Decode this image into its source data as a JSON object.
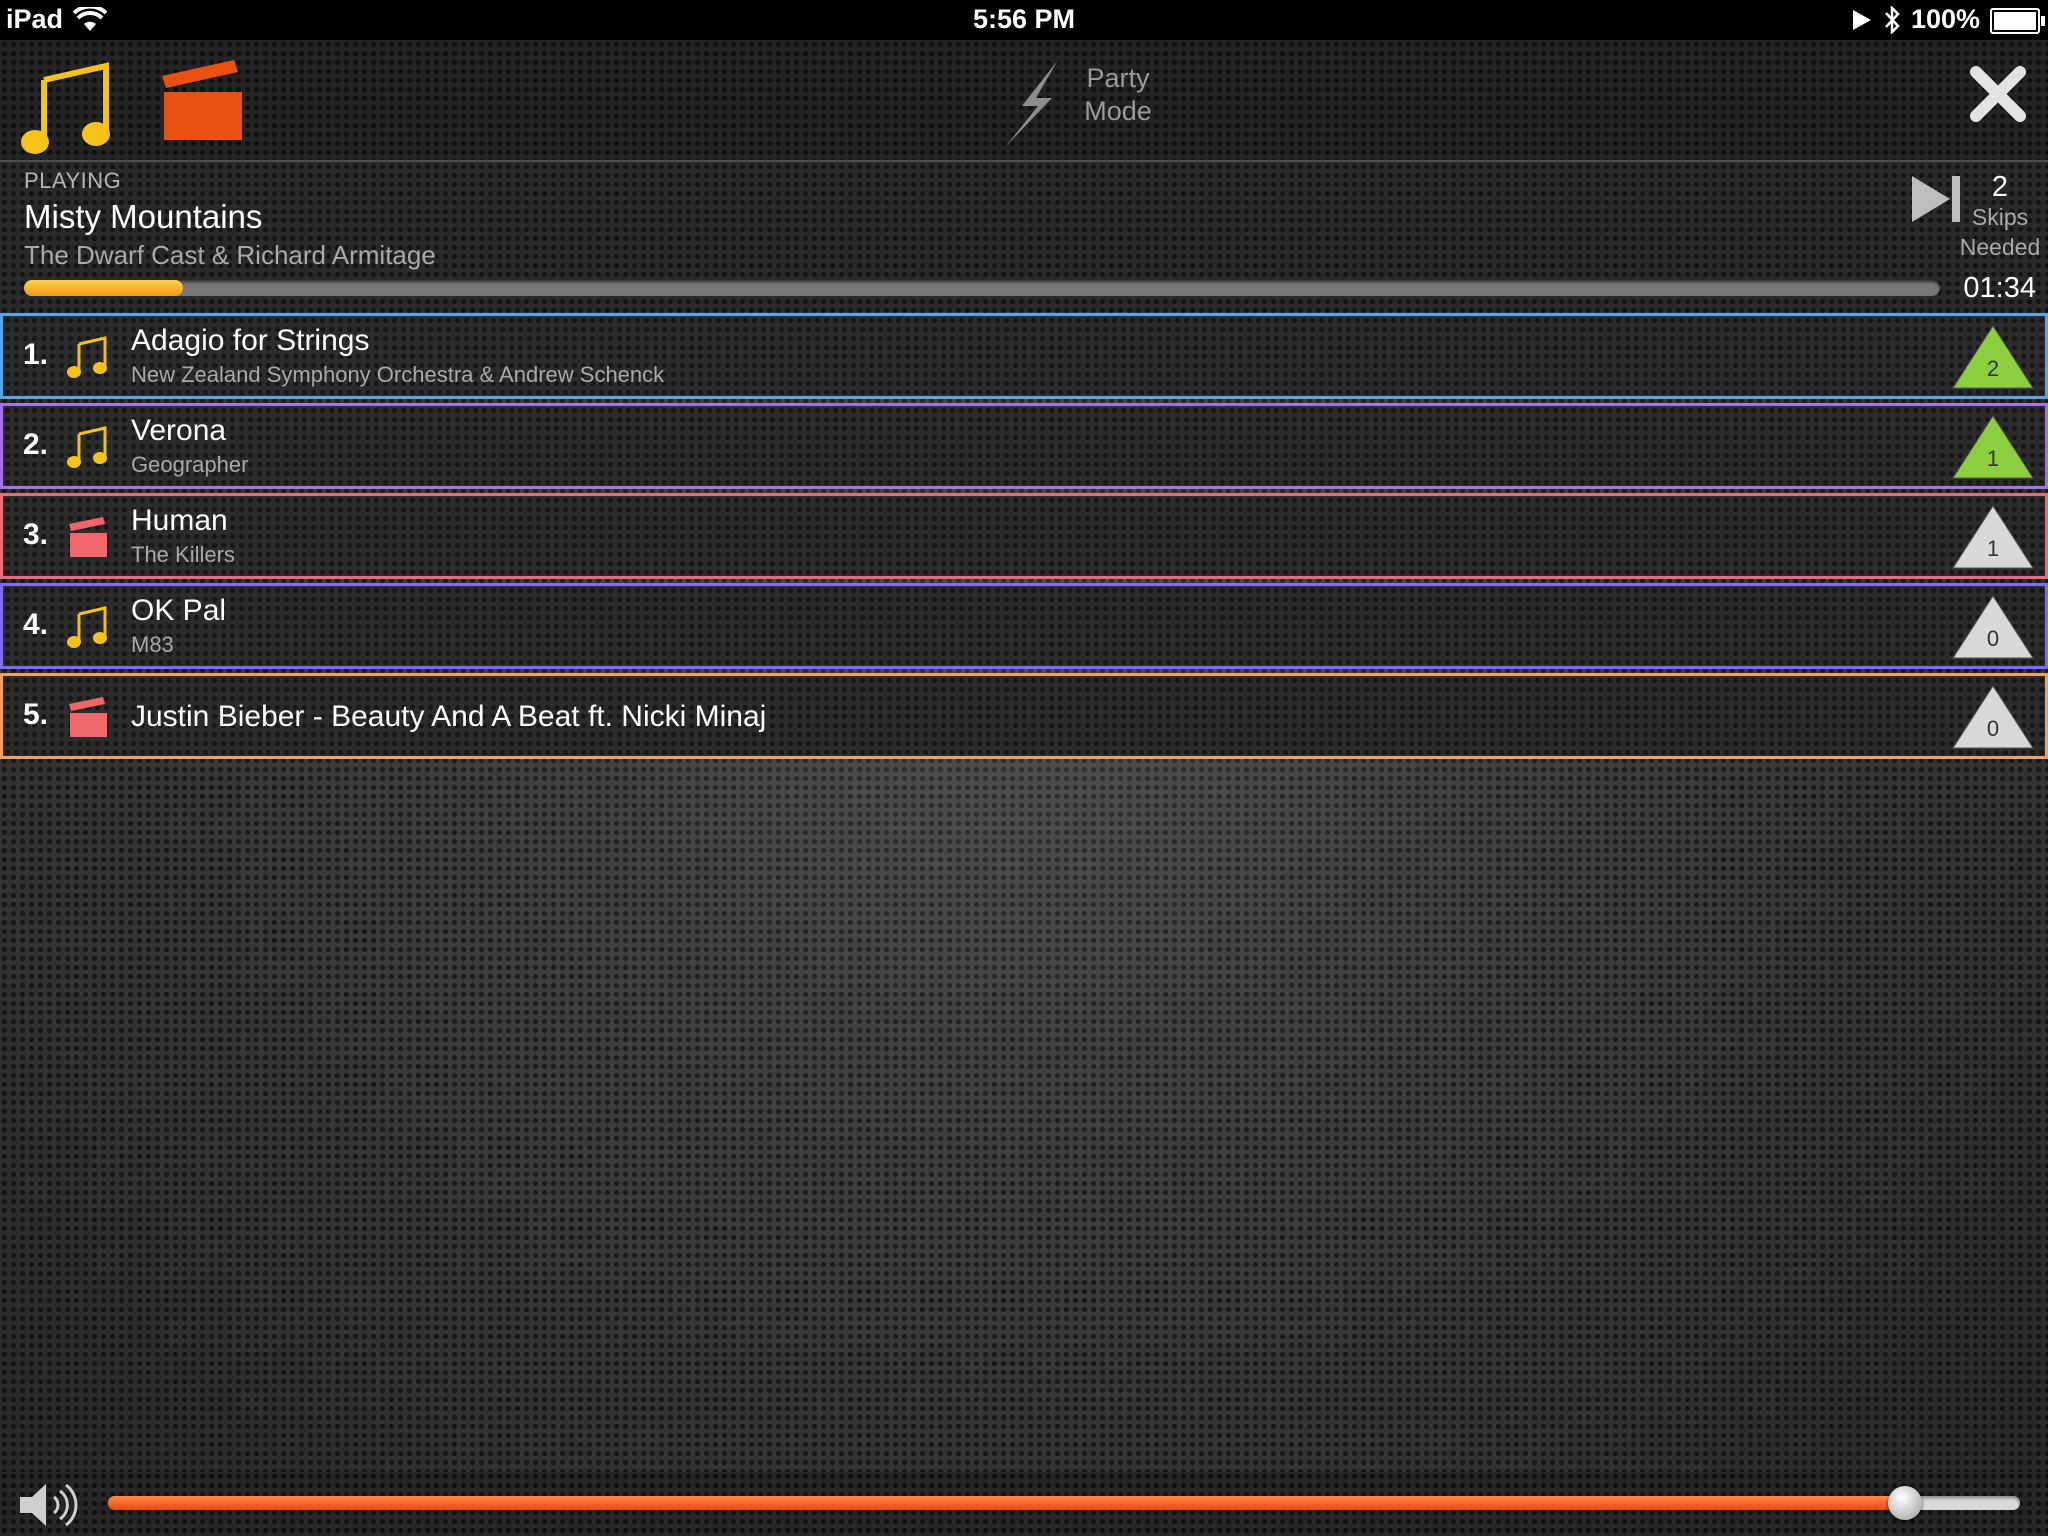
{
  "status_bar": {
    "device": "iPad",
    "time": "5:56 PM",
    "battery": "100%"
  },
  "toolbar": {
    "party_mode_label": "Party\nMode"
  },
  "now_playing": {
    "state": "PLAYING",
    "title": "Misty Mountains",
    "artist": "The Dwarf Cast & Richard Armitage",
    "elapsed": "01:34",
    "progress_fraction": 0.083,
    "skips_count": "2",
    "skips_label": "Skips",
    "skips_needed_label": "Needed"
  },
  "queue": [
    {
      "num": "1.",
      "type": "music",
      "title": "Adagio for Strings",
      "artist": "New Zealand Symphony Orchestra & Andrew Schenck",
      "votes": "2",
      "vote_state": "up",
      "border_color": "#5ba2e6"
    },
    {
      "num": "2.",
      "type": "music",
      "title": "Verona",
      "artist": "Geographer",
      "votes": "1",
      "vote_state": "up",
      "border_color": "#a373e6"
    },
    {
      "num": "3.",
      "type": "video",
      "title": "Human",
      "artist": "The Killers",
      "votes": "1",
      "vote_state": "none",
      "border_color": "#e96b78"
    },
    {
      "num": "4.",
      "type": "music",
      "title": "OK Pal",
      "artist": "M83",
      "votes": "0",
      "vote_state": "none",
      "border_color": "#7b6ff0"
    },
    {
      "num": "5.",
      "type": "video",
      "title": "Justin Bieber - Beauty And A Beat ft. Nicki Minaj",
      "artist": "",
      "votes": "0",
      "vote_state": "none",
      "border_color": "#f0a060"
    }
  ],
  "volume": {
    "level_fraction": 0.94
  },
  "colors": {
    "music_icon": "#f5c219",
    "video_icon_toolbar": "#e8510f",
    "video_icon_row": "#f0676b",
    "vote_up": "#8ccf3e",
    "vote_none": "#d8d8d8",
    "progress_fill": "#f5a623",
    "volume_fill": "#ef5a1b"
  }
}
